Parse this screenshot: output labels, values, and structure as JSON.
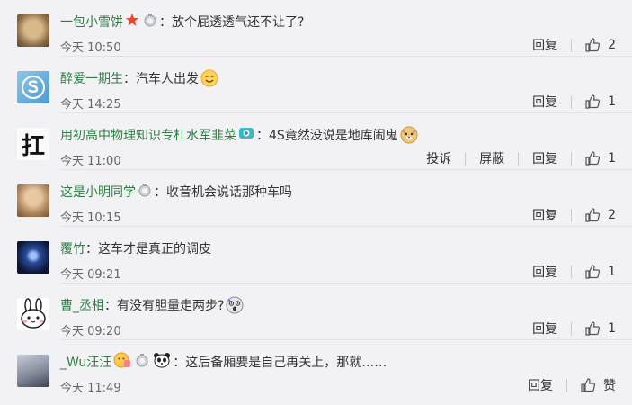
{
  "comments": [
    {
      "user": "一包小雪饼",
      "colon": "：",
      "text": "放个屁透透气还不让了?",
      "time": "今天 10:50",
      "reply": "回复",
      "likes": "2"
    },
    {
      "user": "醉爱一期生",
      "colon": "：",
      "text": "汽车人出发",
      "time": "今天 14:25",
      "reply": "回复",
      "likes": "1"
    },
    {
      "user": "用初高中物理知识专杠水军韭菜",
      "colon": "：",
      "text": "4S竟然没说是地库闹鬼",
      "time": "今天 11:00",
      "report": "投诉",
      "block": "屏蔽",
      "reply": "回复",
      "likes": "1"
    },
    {
      "user": "这是小明同学",
      "colon": "：",
      "text": "收音机会说话那种车吗",
      "time": "今天 10:15",
      "reply": "回复",
      "likes": "2"
    },
    {
      "user": "覆竹",
      "colon": "：",
      "text": "这车才是真正的调皮",
      "time": "今天 09:21",
      "reply": "回复",
      "likes": "1"
    },
    {
      "user": "曹_丞相",
      "colon": "：",
      "text": "有没有胆量走两步?",
      "time": "今天 09:20",
      "reply": "回复",
      "likes": "1"
    },
    {
      "user": "_Wu汪汪",
      "colon": "：",
      "text": "这后备厢要是自己再关上，那就……",
      "time": "今天 11:49",
      "reply": "回复",
      "likes": "赞"
    }
  ],
  "avatar_texts": {
    "third": "扛"
  },
  "icons": [
    "thumbs-up-icon",
    "star-badge-icon",
    "medal-badge-icon",
    "camera-badge-icon",
    "smile-emoji-icon",
    "doge-emoji-icon",
    "scared-emoji-icon",
    "panda-emoji-icon",
    "pray-emoji-icon"
  ],
  "colors": {
    "username": "#2f7d43",
    "background": "#f2f2f5",
    "text": "#333333",
    "meta": "#666666",
    "star": "#e8452c"
  }
}
